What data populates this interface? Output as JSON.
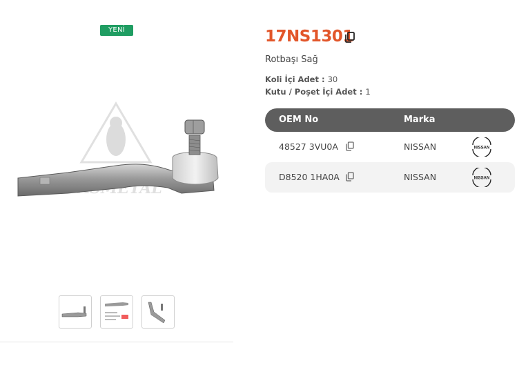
{
  "product": {
    "badge": "YENİ",
    "code": "17NS1301",
    "name": "Rotbaşı Sağ",
    "info": [
      {
        "label": "Koli İçi Adet",
        "value": "30"
      },
      {
        "label": "Kutu / Poşet İçi Adet",
        "value": "1"
      }
    ]
  },
  "table": {
    "headers": {
      "oem": "OEM No",
      "brand": "Marka"
    },
    "rows": [
      {
        "oem": "48527 3VU0A",
        "brand": "NISSAN",
        "logo_text": "NISSAN"
      },
      {
        "oem": "D8520 1HA0A",
        "brand": "NISSAN",
        "logo_text": "NISSAN"
      }
    ]
  },
  "gallery": {
    "watermark": "ASMETAL",
    "thumbnails": [
      "thumbnail-side-view",
      "thumbnail-label-sheet",
      "thumbnail-angle-view"
    ]
  },
  "colors": {
    "accent": "#e2562a",
    "badge": "#1f9d62",
    "header": "#5e5e5e"
  }
}
